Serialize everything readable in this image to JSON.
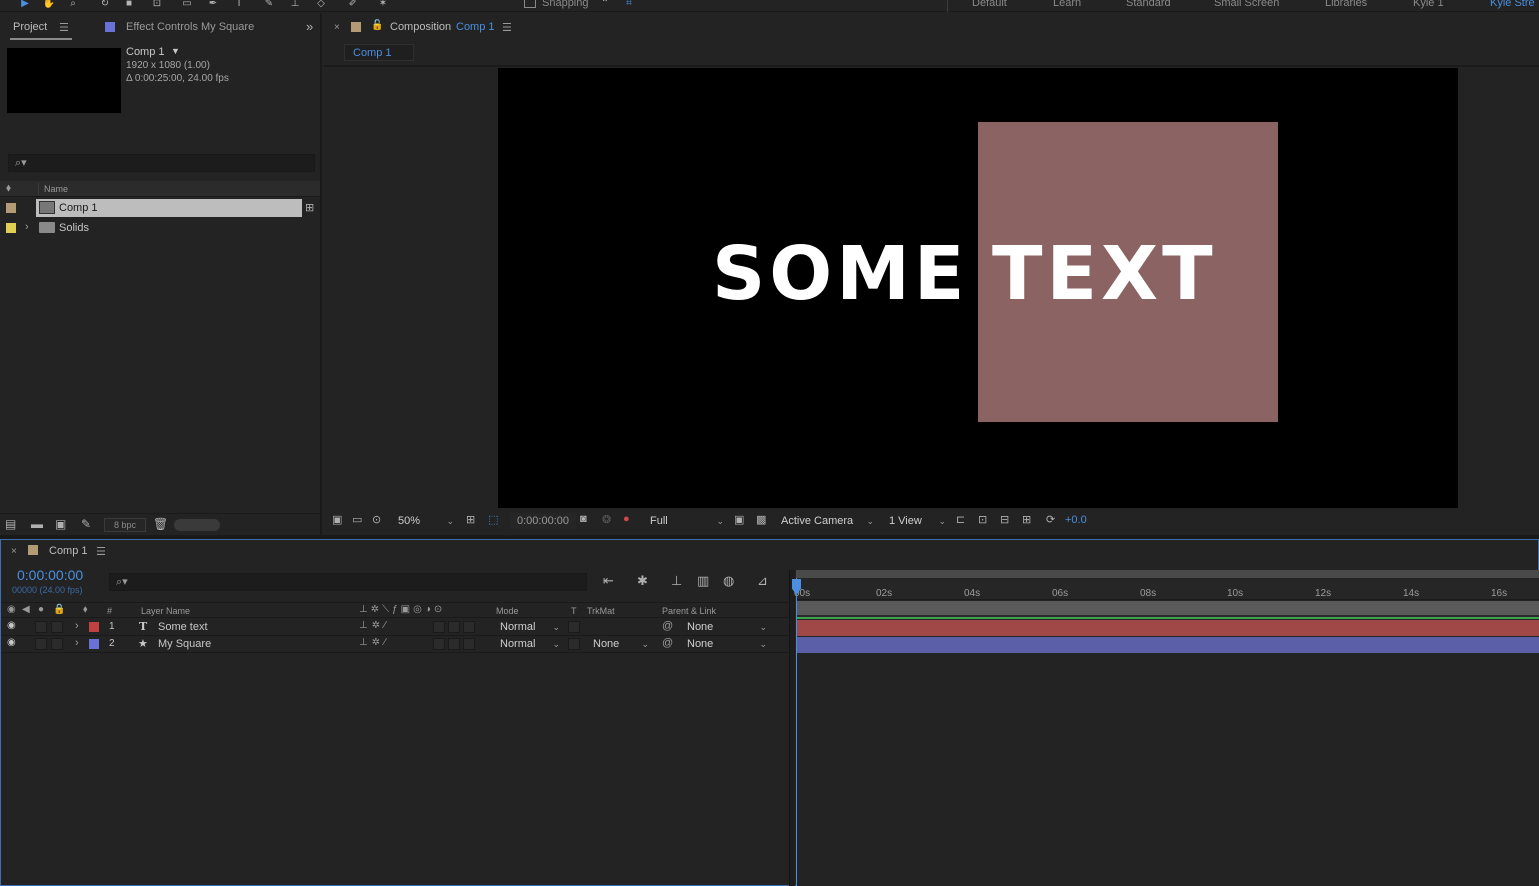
{
  "workspaces": [
    "Default",
    "Learn",
    "Standard",
    "Small Screen",
    "Libraries",
    "Kyle 1",
    "Kyle Stre"
  ],
  "toolbar": {
    "snapping_label": "Snapping"
  },
  "project_panel": {
    "tab_project": "Project",
    "tab_effect_controls_prefix": "Effect Controls",
    "tab_effect_controls_target": "My Square",
    "comp_name": "Comp 1",
    "comp_resolution": "1920 x 1080 (1.00)",
    "comp_duration": "Δ 0:00:25:00, 24.00 fps",
    "col_name": "Name",
    "items": [
      {
        "name": "Comp 1",
        "color": "#b29b75",
        "selected": true
      },
      {
        "name": "Solids",
        "color": "#e0cf53",
        "selected": false
      }
    ],
    "bpc": "8 bpc"
  },
  "composition_panel": {
    "tab_prefix": "Composition",
    "tab_name": "Comp 1",
    "subtab": "Comp 1",
    "zoom": "50%",
    "timecode": "0:00:00:00",
    "resolution": "Full",
    "camera": "Active Camera",
    "views": "1 View",
    "exposure": "+0.0",
    "text_left": "SOME",
    "text_right": "TEXT",
    "square_color": "#8c6363"
  },
  "timeline": {
    "tab_name": "Comp 1",
    "timecode": "0:00:00:00",
    "frame_info": "00000 (24.00 fps)",
    "col_num": "#",
    "col_layer_name": "Layer Name",
    "col_mode": "Mode",
    "col_t": "T",
    "col_trkmat": "TrkMat",
    "col_parent": "Parent & Link",
    "ruler": [
      "00s",
      "02s",
      "04s",
      "06s",
      "08s",
      "10s",
      "12s",
      "14s",
      "16s"
    ],
    "layers": [
      {
        "index": "1",
        "name": "Some text",
        "type_icon": "T",
        "color": "#c14040",
        "mode": "Normal",
        "trkmat": "",
        "parent": "None",
        "bar_color": "#a04848"
      },
      {
        "index": "2",
        "name": "My Square",
        "type_icon": "★",
        "color": "#6a72d8",
        "mode": "Normal",
        "trkmat": "None",
        "parent": "None",
        "bar_color": "#5a5fa8"
      }
    ]
  }
}
